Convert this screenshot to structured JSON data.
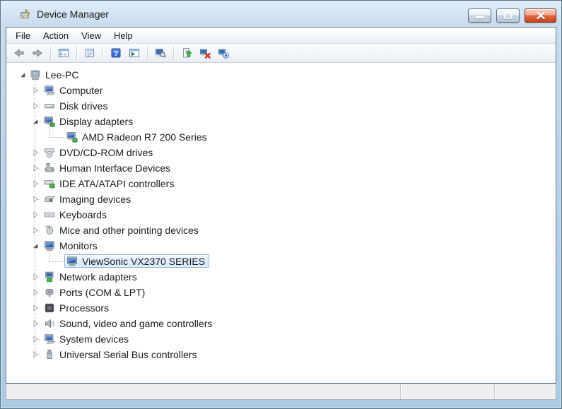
{
  "window": {
    "title": "Device Manager",
    "icon": "device-manager-icon"
  },
  "titlebar": {
    "buttons": [
      {
        "name": "minimize",
        "icon": "minimize-icon"
      },
      {
        "name": "maximize",
        "icon": "maximize-icon"
      },
      {
        "name": "close",
        "icon": "close-icon"
      }
    ]
  },
  "menu": {
    "items": [
      {
        "label": "File"
      },
      {
        "label": "Action"
      },
      {
        "label": "View"
      },
      {
        "label": "Help"
      }
    ]
  },
  "toolbar": {
    "help_glyph": "?",
    "buttons": [
      {
        "name": "back",
        "icon": "back-arrow-icon"
      },
      {
        "name": "forward",
        "icon": "forward-arrow-icon"
      },
      {
        "sep": true
      },
      {
        "name": "show-console-tree",
        "icon": "console-tree-icon"
      },
      {
        "sep": true
      },
      {
        "name": "properties",
        "icon": "properties-icon"
      },
      {
        "sep": true
      },
      {
        "name": "help",
        "icon": "help-icon"
      },
      {
        "name": "show-action-pane",
        "icon": "action-pane-icon"
      },
      {
        "sep": true
      },
      {
        "name": "scan-hardware-changes",
        "icon": "scan-icon"
      },
      {
        "sep": true
      },
      {
        "name": "update-driver",
        "icon": "update-driver-icon"
      },
      {
        "name": "uninstall-device",
        "icon": "uninstall-icon"
      },
      {
        "name": "disable-device",
        "icon": "disable-icon"
      }
    ]
  },
  "tree": {
    "items": [
      {
        "label": "Lee-PC",
        "level": 0,
        "state": "expanded",
        "icon": "computer-root-icon",
        "selected": false
      },
      {
        "label": "Computer",
        "level": 1,
        "state": "collapsed",
        "icon": "computer-icon",
        "selected": false
      },
      {
        "label": "Disk drives",
        "level": 1,
        "state": "collapsed",
        "icon": "disk-drive-icon",
        "selected": false
      },
      {
        "label": "Display adapters",
        "level": 1,
        "state": "expanded",
        "icon": "display-adapter-icon",
        "selected": false
      },
      {
        "label": "AMD Radeon R7 200 Series",
        "level": 2,
        "state": "leaf",
        "icon": "display-adapter-icon",
        "selected": false
      },
      {
        "label": "DVD/CD-ROM drives",
        "level": 1,
        "state": "collapsed",
        "icon": "dvd-drive-icon",
        "selected": false
      },
      {
        "label": "Human Interface Devices",
        "level": 1,
        "state": "collapsed",
        "icon": "hid-icon",
        "selected": false
      },
      {
        "label": "IDE ATA/ATAPI controllers",
        "level": 1,
        "state": "collapsed",
        "icon": "ide-controller-icon",
        "selected": false
      },
      {
        "label": "Imaging devices",
        "level": 1,
        "state": "collapsed",
        "icon": "imaging-device-icon",
        "selected": false
      },
      {
        "label": "Keyboards",
        "level": 1,
        "state": "collapsed",
        "icon": "keyboard-icon",
        "selected": false
      },
      {
        "label": "Mice and other pointing devices",
        "level": 1,
        "state": "collapsed",
        "icon": "mouse-icon",
        "selected": false
      },
      {
        "label": "Monitors",
        "level": 1,
        "state": "expanded",
        "icon": "monitor-icon",
        "selected": false
      },
      {
        "label": "ViewSonic VX2370 SERIES",
        "level": 2,
        "state": "leaf",
        "icon": "monitor-icon",
        "selected": true
      },
      {
        "label": "Network adapters",
        "level": 1,
        "state": "collapsed",
        "icon": "network-adapter-icon",
        "selected": false
      },
      {
        "label": "Ports (COM & LPT)",
        "level": 1,
        "state": "collapsed",
        "icon": "port-icon",
        "selected": false
      },
      {
        "label": "Processors",
        "level": 1,
        "state": "collapsed",
        "icon": "processor-icon",
        "selected": false
      },
      {
        "label": "Sound, video and game controllers",
        "level": 1,
        "state": "collapsed",
        "icon": "sound-icon",
        "selected": false
      },
      {
        "label": "System devices",
        "level": 1,
        "state": "collapsed",
        "icon": "system-device-icon",
        "selected": false
      },
      {
        "label": "Universal Serial Bus controllers",
        "level": 1,
        "state": "collapsed",
        "icon": "usb-controller-icon",
        "selected": false
      }
    ]
  },
  "statusbar": {
    "sections": [
      "",
      "",
      ""
    ]
  },
  "colors": {
    "frame": "#b5d0e7",
    "titlebar_text": "#1c1c1c",
    "close_button": "#d15a33",
    "selection_border": "#84b0da",
    "selection_fill": "#dcecfb",
    "statusbar_bg": "#f0eef1",
    "tree_text": "#1b1b1b"
  }
}
